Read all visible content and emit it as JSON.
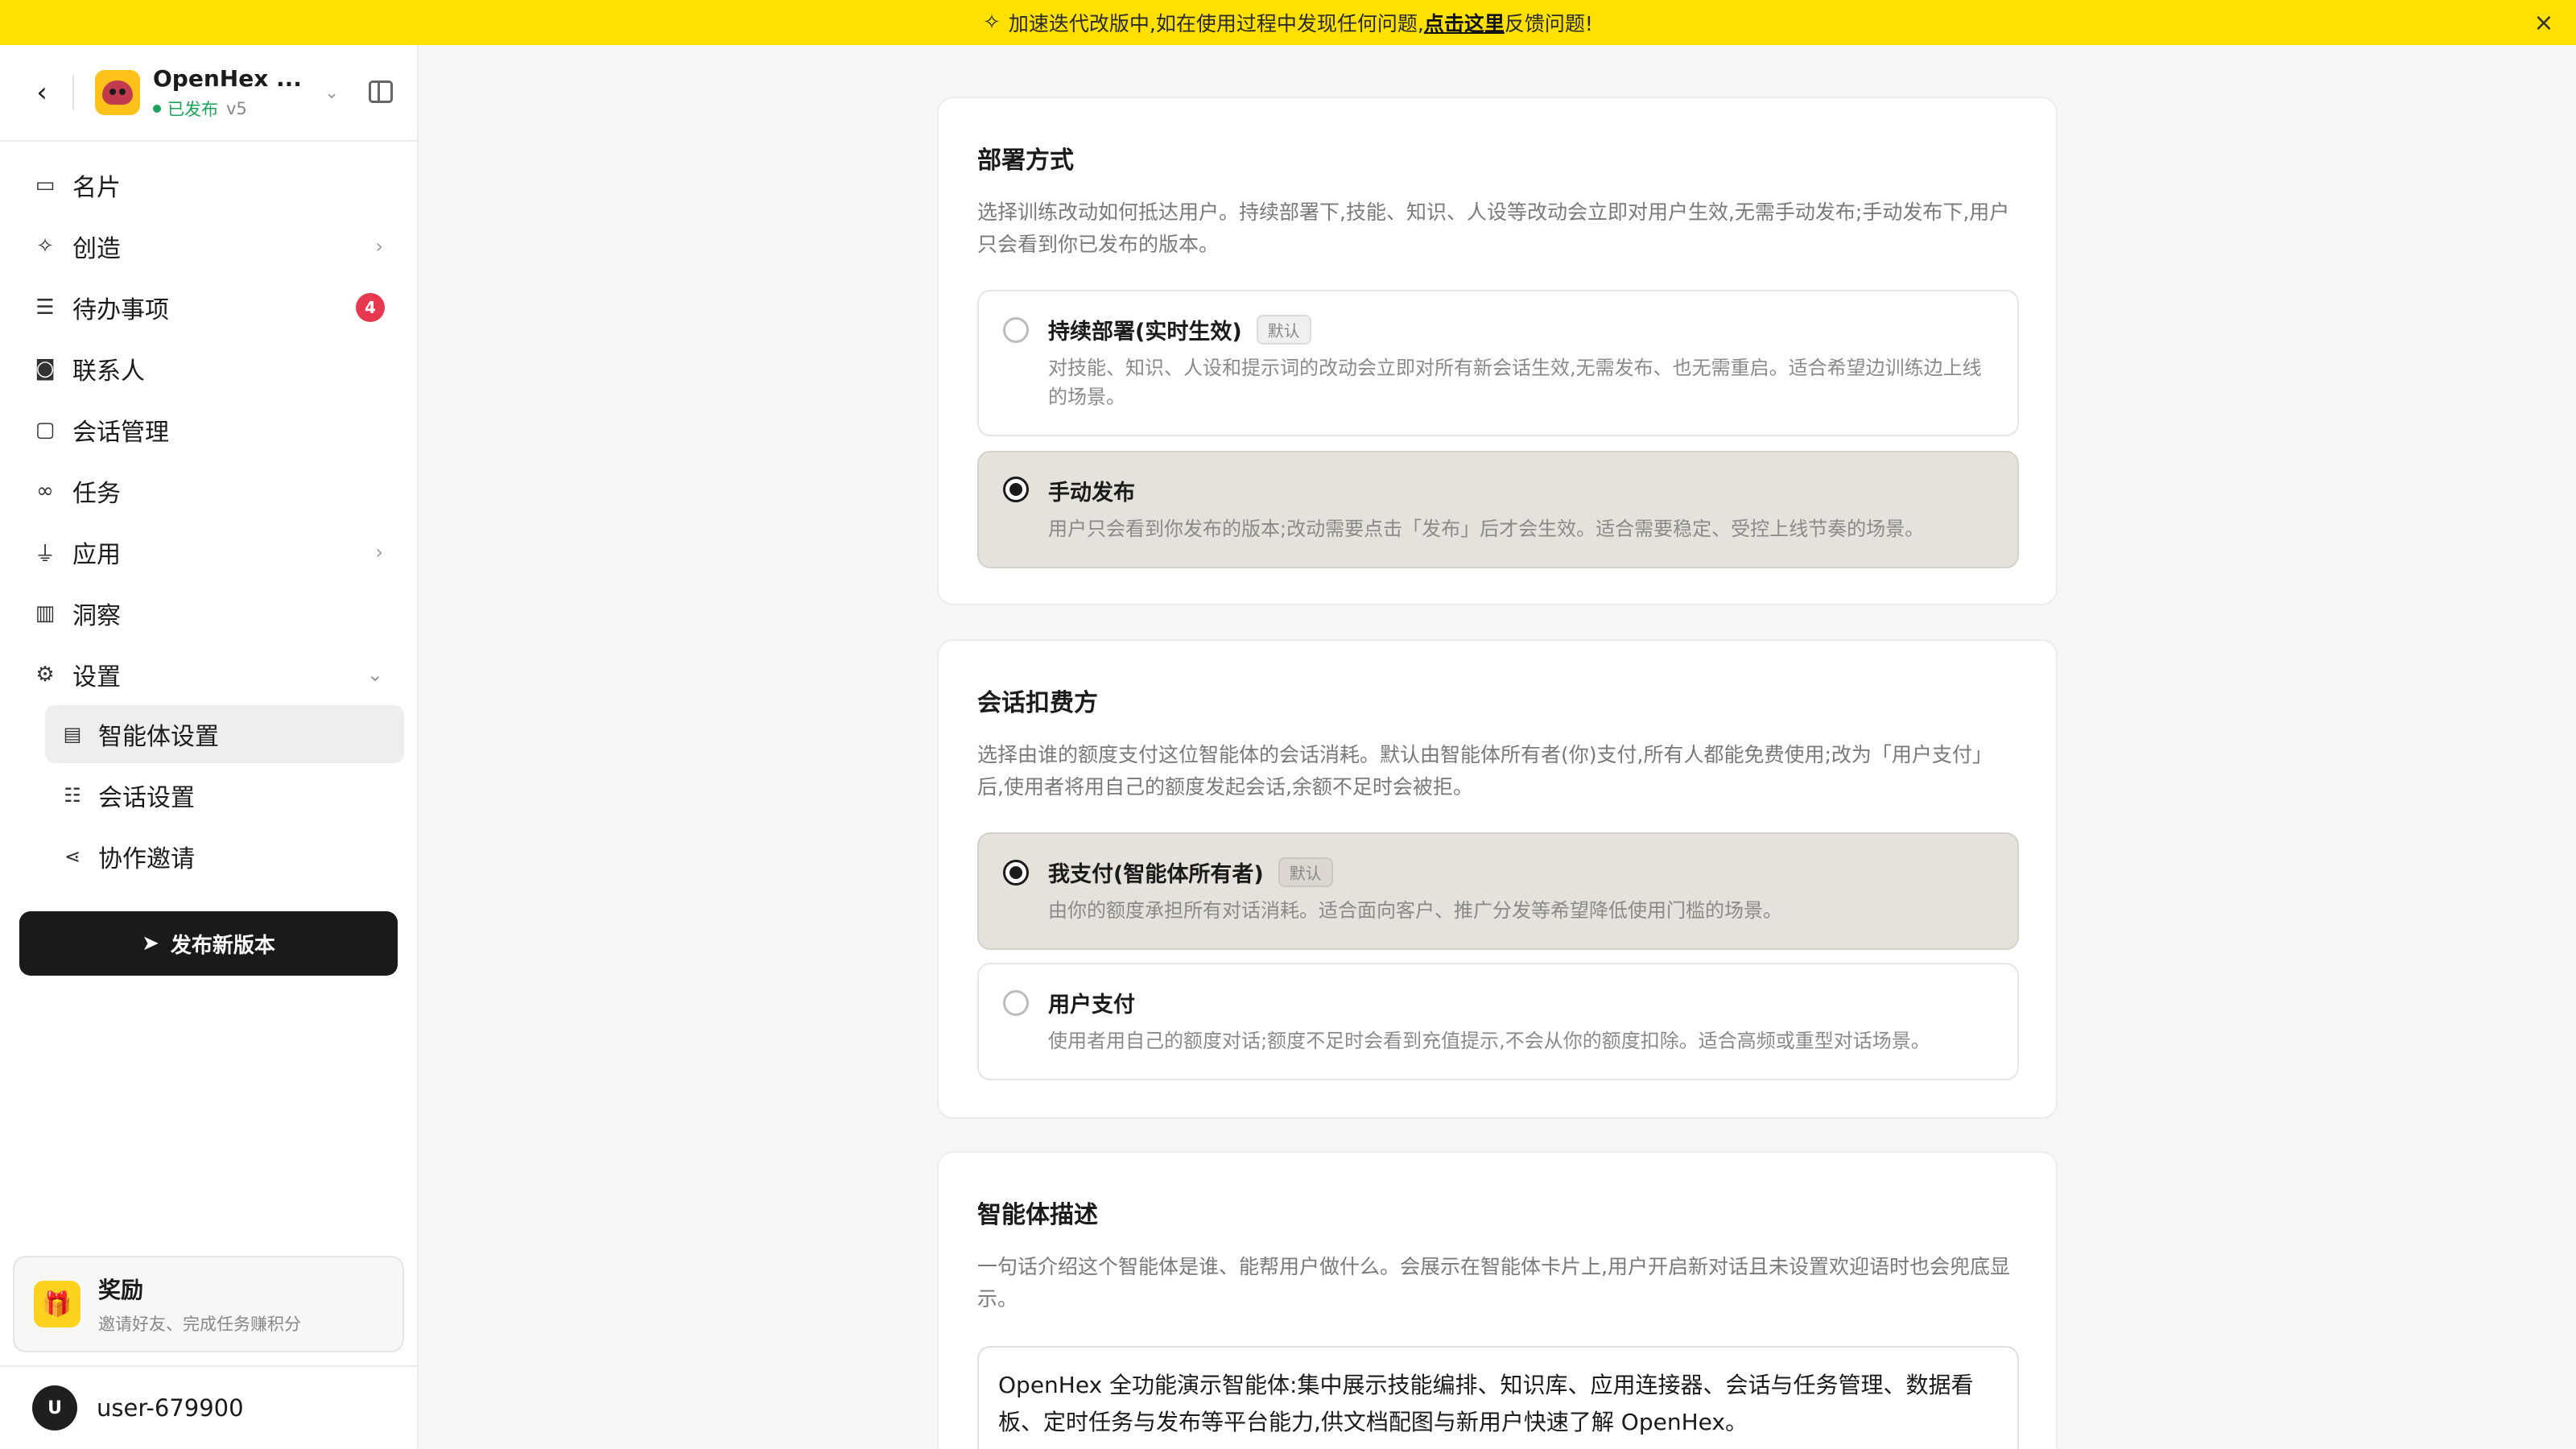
{
  "banner": {
    "prefix": "加速迭代改版中,如在使用过程中发现任何问题,",
    "link": "点击这里",
    "suffix": "反馈问题!"
  },
  "app": {
    "name": "OpenHex ...",
    "status": "已发布",
    "version": "v5"
  },
  "nav": {
    "card": "名片",
    "create": "创造",
    "todo": "待办事项",
    "todo_badge": "4",
    "contacts": "联系人",
    "sessions": "会话管理",
    "tasks": "任务",
    "apps": "应用",
    "insights": "洞察",
    "settings": "设置",
    "sub": {
      "agent_settings": "智能体设置",
      "session_settings": "会话设置",
      "collab_invite": "协作邀请"
    }
  },
  "publish_button": "发布新版本",
  "rewards": {
    "title": "奖励",
    "subtitle": "邀请好友、完成任务赚积分"
  },
  "user": {
    "initial": "U",
    "name": "user-679900"
  },
  "deploy": {
    "title": "部署方式",
    "description": "选择训练改动如何抵达用户。持续部署下,技能、知识、人设等改动会立即对用户生效,无需手动发布;手动发布下,用户只会看到你已发布的版本。",
    "options": [
      {
        "title": "持续部署(实时生效)",
        "tag": "默认",
        "desc": "对技能、知识、人设和提示词的改动会立即对所有新会话生效,无需发布、也无需重启。适合希望边训练边上线的场景。",
        "selected": false
      },
      {
        "title": "手动发布",
        "desc": "用户只会看到你发布的版本;改动需要点击「发布」后才会生效。适合需要稳定、受控上线节奏的场景。",
        "selected": true
      }
    ]
  },
  "billing": {
    "title": "会话扣费方",
    "description": "选择由谁的额度支付这位智能体的会话消耗。默认由智能体所有者(你)支付,所有人都能免费使用;改为「用户支付」后,使用者将用自己的额度发起会话,余额不足时会被拒。",
    "options": [
      {
        "title": "我支付(智能体所有者)",
        "tag": "默认",
        "desc": "由你的额度承担所有对话消耗。适合面向客户、推广分发等希望降低使用门槛的场景。",
        "selected": true
      },
      {
        "title": "用户支付",
        "desc": "使用者用自己的额度对话;额度不足时会看到充值提示,不会从你的额度扣除。适合高频或重型对话场景。",
        "selected": false
      }
    ]
  },
  "agent_desc": {
    "title": "智能体描述",
    "description": "一句话介绍这个智能体是谁、能帮用户做什么。会展示在智能体卡片上,用户开启新对话且未设置欢迎语时也会兜底显示。",
    "value": "OpenHex 全功能演示智能体:集中展示技能编排、知识库、应用连接器、会话与任务管理、数据看板、定时任务与发布等平台能力,供文档配图与新用户快速了解 OpenHex。"
  }
}
